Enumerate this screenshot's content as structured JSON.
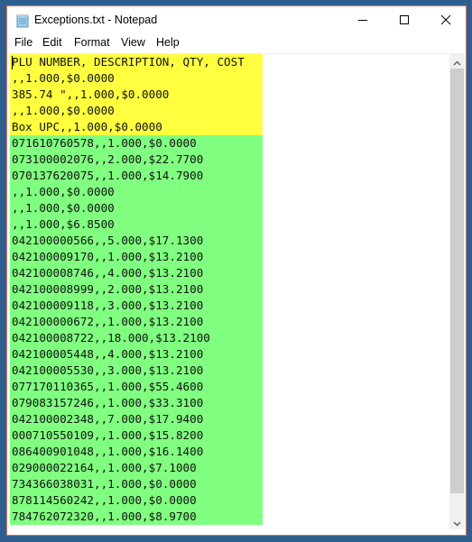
{
  "window": {
    "title": "Exceptions.txt - Notepad",
    "icon": "notepad-icon",
    "controls": {
      "minimize": "minimize-icon",
      "maximize": "maximize-icon",
      "close": "close-icon"
    }
  },
  "menu": {
    "items": [
      "File",
      "Edit",
      "Format",
      "View",
      "Help"
    ]
  },
  "editor": {
    "highlight_colors": {
      "yellow": "#ffff40",
      "green": "#80ff80"
    },
    "lines": [
      {
        "text": "PLU NUMBER, DESCRIPTION, QTY, COST",
        "highlight": "yellow"
      },
      {
        "text": ",,1.000,$0.0000",
        "highlight": "yellow"
      },
      {
        "text": "385.74 \",,1.000,$0.0000",
        "highlight": "yellow"
      },
      {
        "text": ",,1.000,$0.0000",
        "highlight": "yellow"
      },
      {
        "text": "Box UPC,,1.000,$0.0000",
        "highlight": "yellow"
      },
      {
        "text": "071610760578,,1.000,$0.0000",
        "highlight": "green"
      },
      {
        "text": "073100002076,,2.000,$22.7700",
        "highlight": "green"
      },
      {
        "text": "070137620075,,1.000,$14.7900",
        "highlight": "green"
      },
      {
        "text": ",,1.000,$0.0000",
        "highlight": "green"
      },
      {
        "text": ",,1.000,$0.0000",
        "highlight": "green"
      },
      {
        "text": ",,1.000,$6.8500",
        "highlight": "green"
      },
      {
        "text": "042100000566,,5.000,$17.1300",
        "highlight": "green"
      },
      {
        "text": "042100009170,,1.000,$13.2100",
        "highlight": "green"
      },
      {
        "text": "042100008746,,4.000,$13.2100",
        "highlight": "green"
      },
      {
        "text": "042100008999,,2.000,$13.2100",
        "highlight": "green"
      },
      {
        "text": "042100009118,,3.000,$13.2100",
        "highlight": "green"
      },
      {
        "text": "042100000672,,1.000,$13.2100",
        "highlight": "green"
      },
      {
        "text": "042100008722,,18.000,$13.2100",
        "highlight": "green"
      },
      {
        "text": "042100005448,,4.000,$13.2100",
        "highlight": "green"
      },
      {
        "text": "042100005530,,3.000,$13.2100",
        "highlight": "green"
      },
      {
        "text": "077170110365,,1.000,$55.4600",
        "highlight": "green"
      },
      {
        "text": "079083157246,,1.000,$33.3100",
        "highlight": "green"
      },
      {
        "text": "042100002348,,7.000,$17.9400",
        "highlight": "green"
      },
      {
        "text": "000710550109,,1.000,$15.8200",
        "highlight": "green"
      },
      {
        "text": "086400901048,,1.000,$16.1400",
        "highlight": "green"
      },
      {
        "text": "029000022164,,1.000,$7.1000",
        "highlight": "green"
      },
      {
        "text": "734366038031,,1.000,$0.0000",
        "highlight": "green"
      },
      {
        "text": "878114560242,,1.000,$0.0000",
        "highlight": "green"
      },
      {
        "text": "784762072320,,1.000,$8.9700",
        "highlight": "green"
      }
    ]
  },
  "scrollbar": {
    "up": "chevron-up-icon",
    "down": "chevron-down-icon"
  }
}
